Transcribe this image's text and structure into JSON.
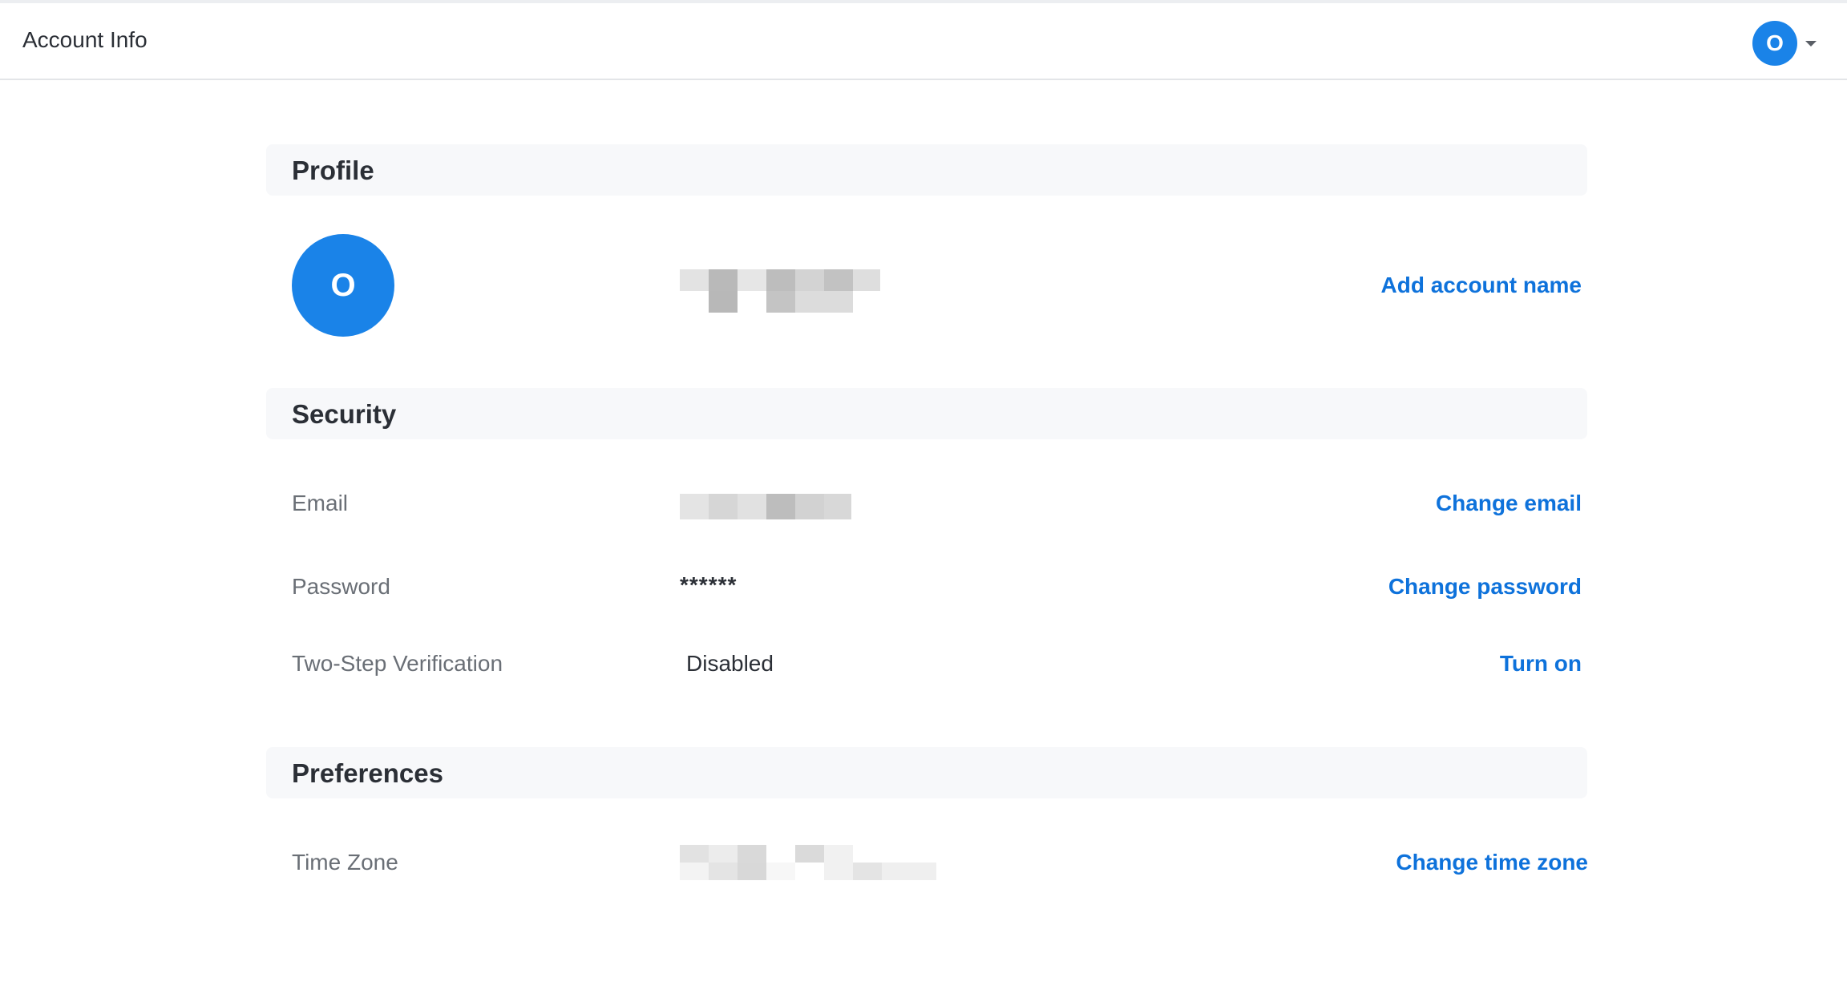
{
  "header": {
    "title": "Account Info",
    "avatar_initial": "O"
  },
  "profile": {
    "section_title": "Profile",
    "avatar_initial": "O",
    "add_name_label": "Add account name"
  },
  "security": {
    "section_title": "Security",
    "email_label": "Email",
    "change_email_label": "Change email",
    "password_label": "Password",
    "password_value": "******",
    "change_password_label": "Change password",
    "two_step_label": "Two-Step Verification",
    "two_step_value": "Disabled",
    "turn_on_label": "Turn on"
  },
  "preferences": {
    "section_title": "Preferences",
    "time_zone_label": "Time Zone",
    "change_time_zone_label": "Change time zone"
  },
  "colors": {
    "accent": "#0e72db",
    "avatar": "#1a83e8",
    "section_bg": "#f7f8fa"
  }
}
